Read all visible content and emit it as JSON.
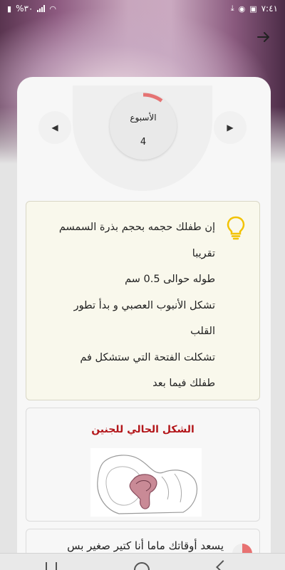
{
  "status_bar": {
    "time": "٧:٤١",
    "battery": "%٣٠",
    "icons": [
      "download-icon",
      "whatsapp-icon",
      "image-icon",
      "wifi-icon",
      "signal-icon",
      "battery-icon"
    ]
  },
  "header": {
    "back_icon": "arrow-right-icon"
  },
  "week_selector": {
    "label": "الأسبوع",
    "number": "4",
    "progress_fraction": 0.1,
    "accent_color": "#e57373",
    "prev_icon": "triangle-left-icon",
    "next_icon": "triangle-right-icon"
  },
  "info_card": {
    "icon": "lightbulb-icon",
    "icon_color": "#f2c200",
    "lines": [
      "إن طفلك حجمه بحجم بذرة السمسم",
      "تقريبا",
      "طوله حوالى 0.5 سم",
      "تشكل الأنبوب العصبي و بدأ تطور",
      "القلب",
      "تشكلت الفتحة التي ستشكل فم",
      "طفلك فيما بعد"
    ]
  },
  "shape_card": {
    "title": "الشكل الحالي للجنين",
    "title_color": "#b3161a",
    "image": "fetus-illustration"
  },
  "quote_card": {
    "text": "يسعد أوقاتك ماما أنا كتير صغير بس"
  },
  "nav_bar": {
    "items": [
      "recent-apps-icon",
      "home-icon",
      "back-icon"
    ]
  }
}
